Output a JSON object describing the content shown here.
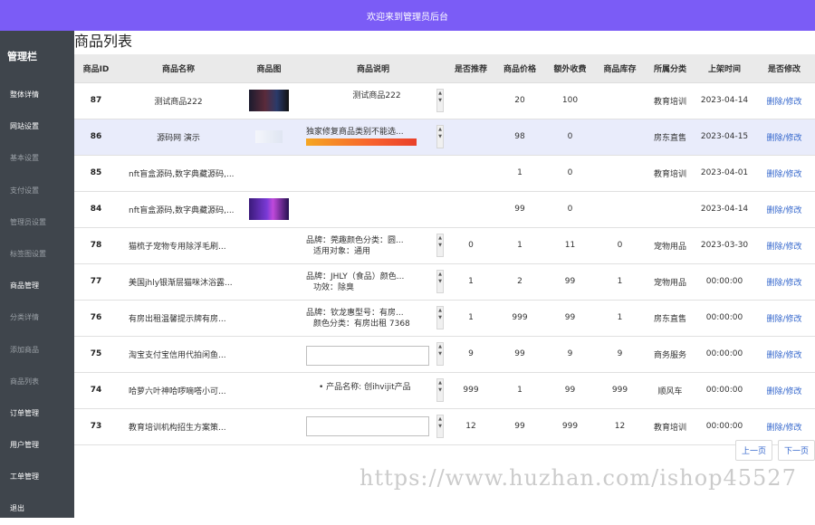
{
  "header": {
    "title": "欢迎来到管理员后台"
  },
  "sidebar": {
    "title": "管理栏",
    "items": [
      {
        "label": "整体详情",
        "dim": false
      },
      {
        "label": "网站设置",
        "dim": false
      },
      {
        "label": "基本设置",
        "dim": true
      },
      {
        "label": "支付设置",
        "dim": true
      },
      {
        "label": "管理员设置",
        "dim": true
      },
      {
        "label": "标签图设置",
        "dim": true
      },
      {
        "label": "商品管理",
        "dim": false
      },
      {
        "label": "分类详情",
        "dim": true
      },
      {
        "label": "添加商品",
        "dim": true
      },
      {
        "label": "商品列表",
        "dim": true
      },
      {
        "label": "订单管理",
        "dim": false
      },
      {
        "label": "用户管理",
        "dim": false
      },
      {
        "label": "工单管理",
        "dim": false
      },
      {
        "label": "退出",
        "dim": false
      }
    ]
  },
  "main": {
    "title": "商品列表",
    "columns": [
      "商品ID",
      "商品名称",
      "商品图",
      "商品说明",
      "是否推荐",
      "商品价格",
      "额外收费",
      "商品库存",
      "所属分类",
      "上架时间",
      "是否修改"
    ],
    "rows": [
      {
        "id": "87",
        "name": "测试商品222",
        "img": "dark",
        "desc_type": "center",
        "desc": [
          "测试商品222"
        ],
        "recommend": "",
        "price": "20",
        "extra": "100",
        "stock": "",
        "category": "教育培训",
        "time": "2023-04-14",
        "action": "删除/修改",
        "scroll": true
      },
      {
        "id": "86",
        "name": "源码网 演示",
        "img": "light",
        "desc_type": "banner",
        "desc": [
          "独家修复商品类别不能选..."
        ],
        "recommend": "",
        "price": "98",
        "extra": "0",
        "stock": "",
        "category": "房东直售",
        "time": "2023-04-15",
        "action": "删除/修改",
        "scroll": true
      },
      {
        "id": "85",
        "name": "nft盲盒源码,数字典藏源码,...",
        "img": "",
        "desc_type": "none",
        "desc": [],
        "recommend": "",
        "price": "1",
        "extra": "0",
        "stock": "",
        "category": "教育培训",
        "time": "2023-04-01",
        "action": "删除/修改",
        "scroll": false
      },
      {
        "id": "84",
        "name": "nft盲盒源码,数字典藏源码,...",
        "img": "purple",
        "desc_type": "none",
        "desc": [],
        "recommend": "",
        "price": "99",
        "extra": "0",
        "stock": "",
        "category": "",
        "time": "2023-04-14",
        "action": "删除/修改",
        "scroll": false
      },
      {
        "id": "78",
        "name": "猫梳子宠物专用除浮毛刷...",
        "img": "",
        "desc_type": "text",
        "desc": [
          "品牌：莞趣颜色分类：圆...",
          "适用对象：通用"
        ],
        "recommend": "0",
        "price": "1",
        "extra": "11",
        "stock": "0",
        "category": "宠物用品",
        "time": "2023-03-30",
        "action": "删除/修改",
        "scroll": true
      },
      {
        "id": "77",
        "name": "美国jhly银渐层猫咪沐浴露...",
        "img": "",
        "desc_type": "text",
        "desc": [
          "品牌：JHLY（食品）颜色...",
          "功效：除臭"
        ],
        "recommend": "1",
        "price": "2",
        "extra": "99",
        "stock": "1",
        "category": "宠物用品",
        "time": "00:00:00",
        "action": "删除/修改",
        "scroll": true
      },
      {
        "id": "76",
        "name": "有房出租温馨提示牌有房...",
        "img": "",
        "desc_type": "text",
        "desc": [
          "品牌：钦龙惠型号：有房...",
          "颜色分类：有房出租 7368"
        ],
        "recommend": "1",
        "price": "999",
        "extra": "99",
        "stock": "1",
        "category": "房东直售",
        "time": "00:00:00",
        "action": "删除/修改",
        "scroll": true
      },
      {
        "id": "75",
        "name": "淘宝支付宝信用代拍闲鱼...",
        "img": "",
        "desc_type": "broken",
        "desc": [],
        "recommend": "9",
        "price": "99",
        "extra": "9",
        "stock": "9",
        "category": "商务服务",
        "time": "00:00:00",
        "action": "删除/修改",
        "scroll": true
      },
      {
        "id": "74",
        "name": "哈萝六叶神哈啰嘀嗒小可...",
        "img": "",
        "desc_type": "bullet",
        "desc": [
          "产品名称: 创ihvijit产品"
        ],
        "recommend": "999",
        "price": "1",
        "extra": "99",
        "stock": "999",
        "category": "顺风车",
        "time": "00:00:00",
        "action": "删除/修改",
        "scroll": true
      },
      {
        "id": "73",
        "name": "教育培训机构招生方案策...",
        "img": "",
        "desc_type": "broken2",
        "desc": [],
        "recommend": "12",
        "price": "99",
        "extra": "999",
        "stock": "12",
        "category": "教育培训",
        "time": "00:00:00",
        "action": "删除/修改",
        "scroll": true
      }
    ]
  },
  "pager": {
    "prev": "上一页",
    "next": "下一页"
  },
  "watermark": "https://www.huzhan.com/ishop45527",
  "colors": {
    "topbar": "#7b5cf6",
    "sidebar": "#3f454c",
    "link": "#3366cc",
    "highlight_row": "#e9ecfb"
  }
}
